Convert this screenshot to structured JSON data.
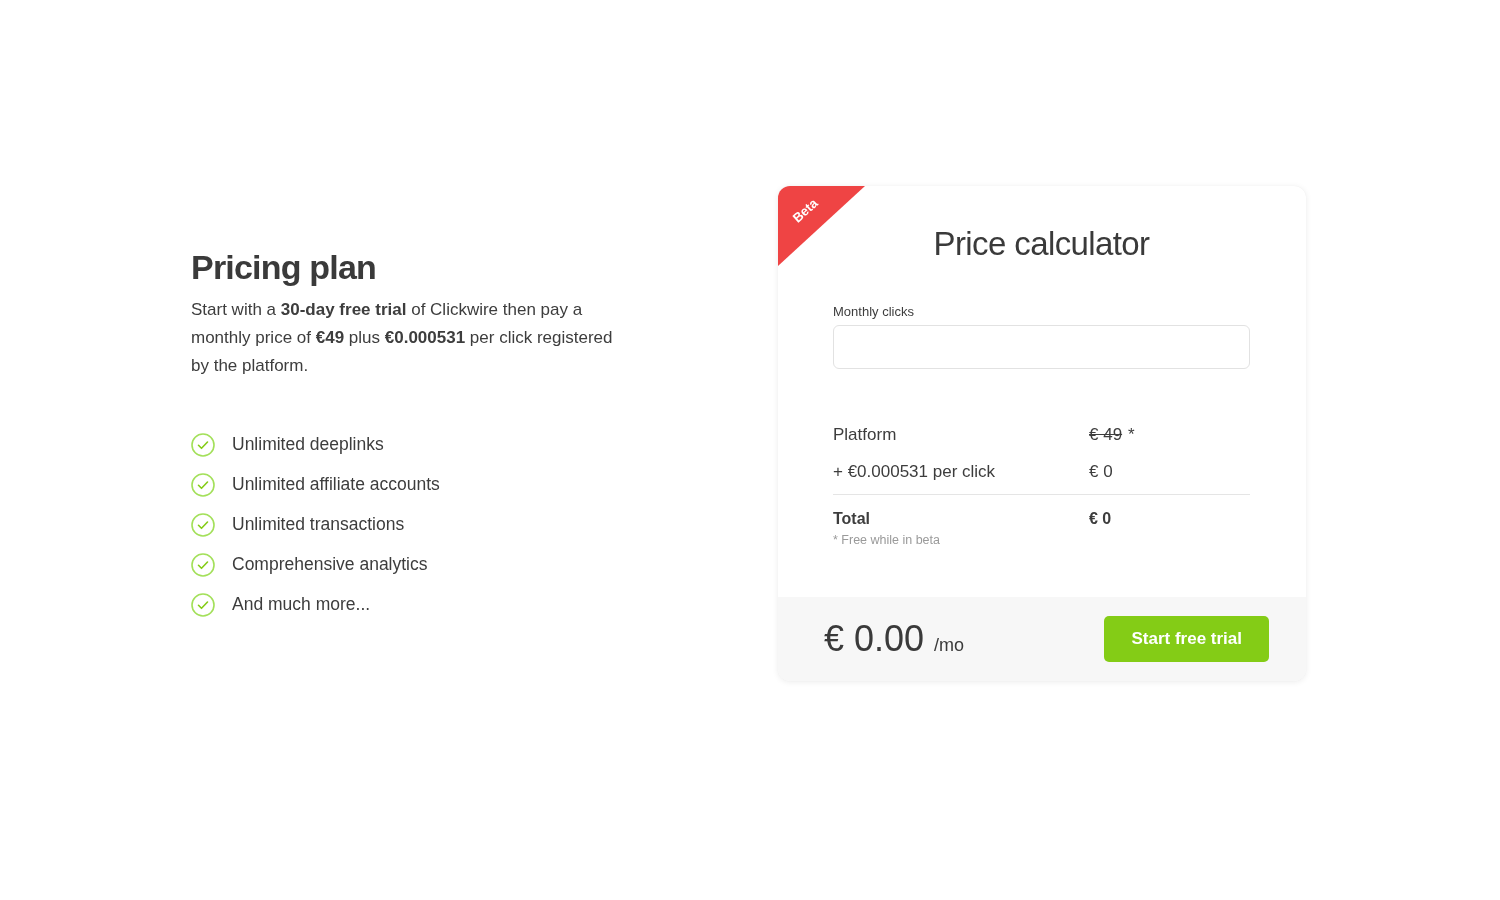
{
  "pricing_plan": {
    "title": "Pricing plan",
    "description": "Start with a **30-day free trial** of Clickwire then pay a monthly price of **€49** plus **€0.000531** per click registered by the platform.",
    "features": [
      "Unlimited deeplinks",
      "Unlimited affiliate accounts",
      "Unlimited transactions",
      "Comprehensive analytics",
      "And much more..."
    ]
  },
  "calculator": {
    "badge": "Beta",
    "title": "Price calculator",
    "monthly_clicks": {
      "label": "Monthly clicks"
    },
    "lines": [
      {
        "label": "Platform",
        "value": "€ 49",
        "struck": true,
        "note": "*"
      },
      {
        "label": "+ €0.000531 per click",
        "value": "€ 0",
        "struck": false
      }
    ],
    "total": {
      "label": "Total",
      "value": "€ 0"
    },
    "footnote": "* Free while in beta",
    "footer": {
      "price": "€ 0.00",
      "period": "/mo",
      "button": "Start free trial"
    }
  }
}
